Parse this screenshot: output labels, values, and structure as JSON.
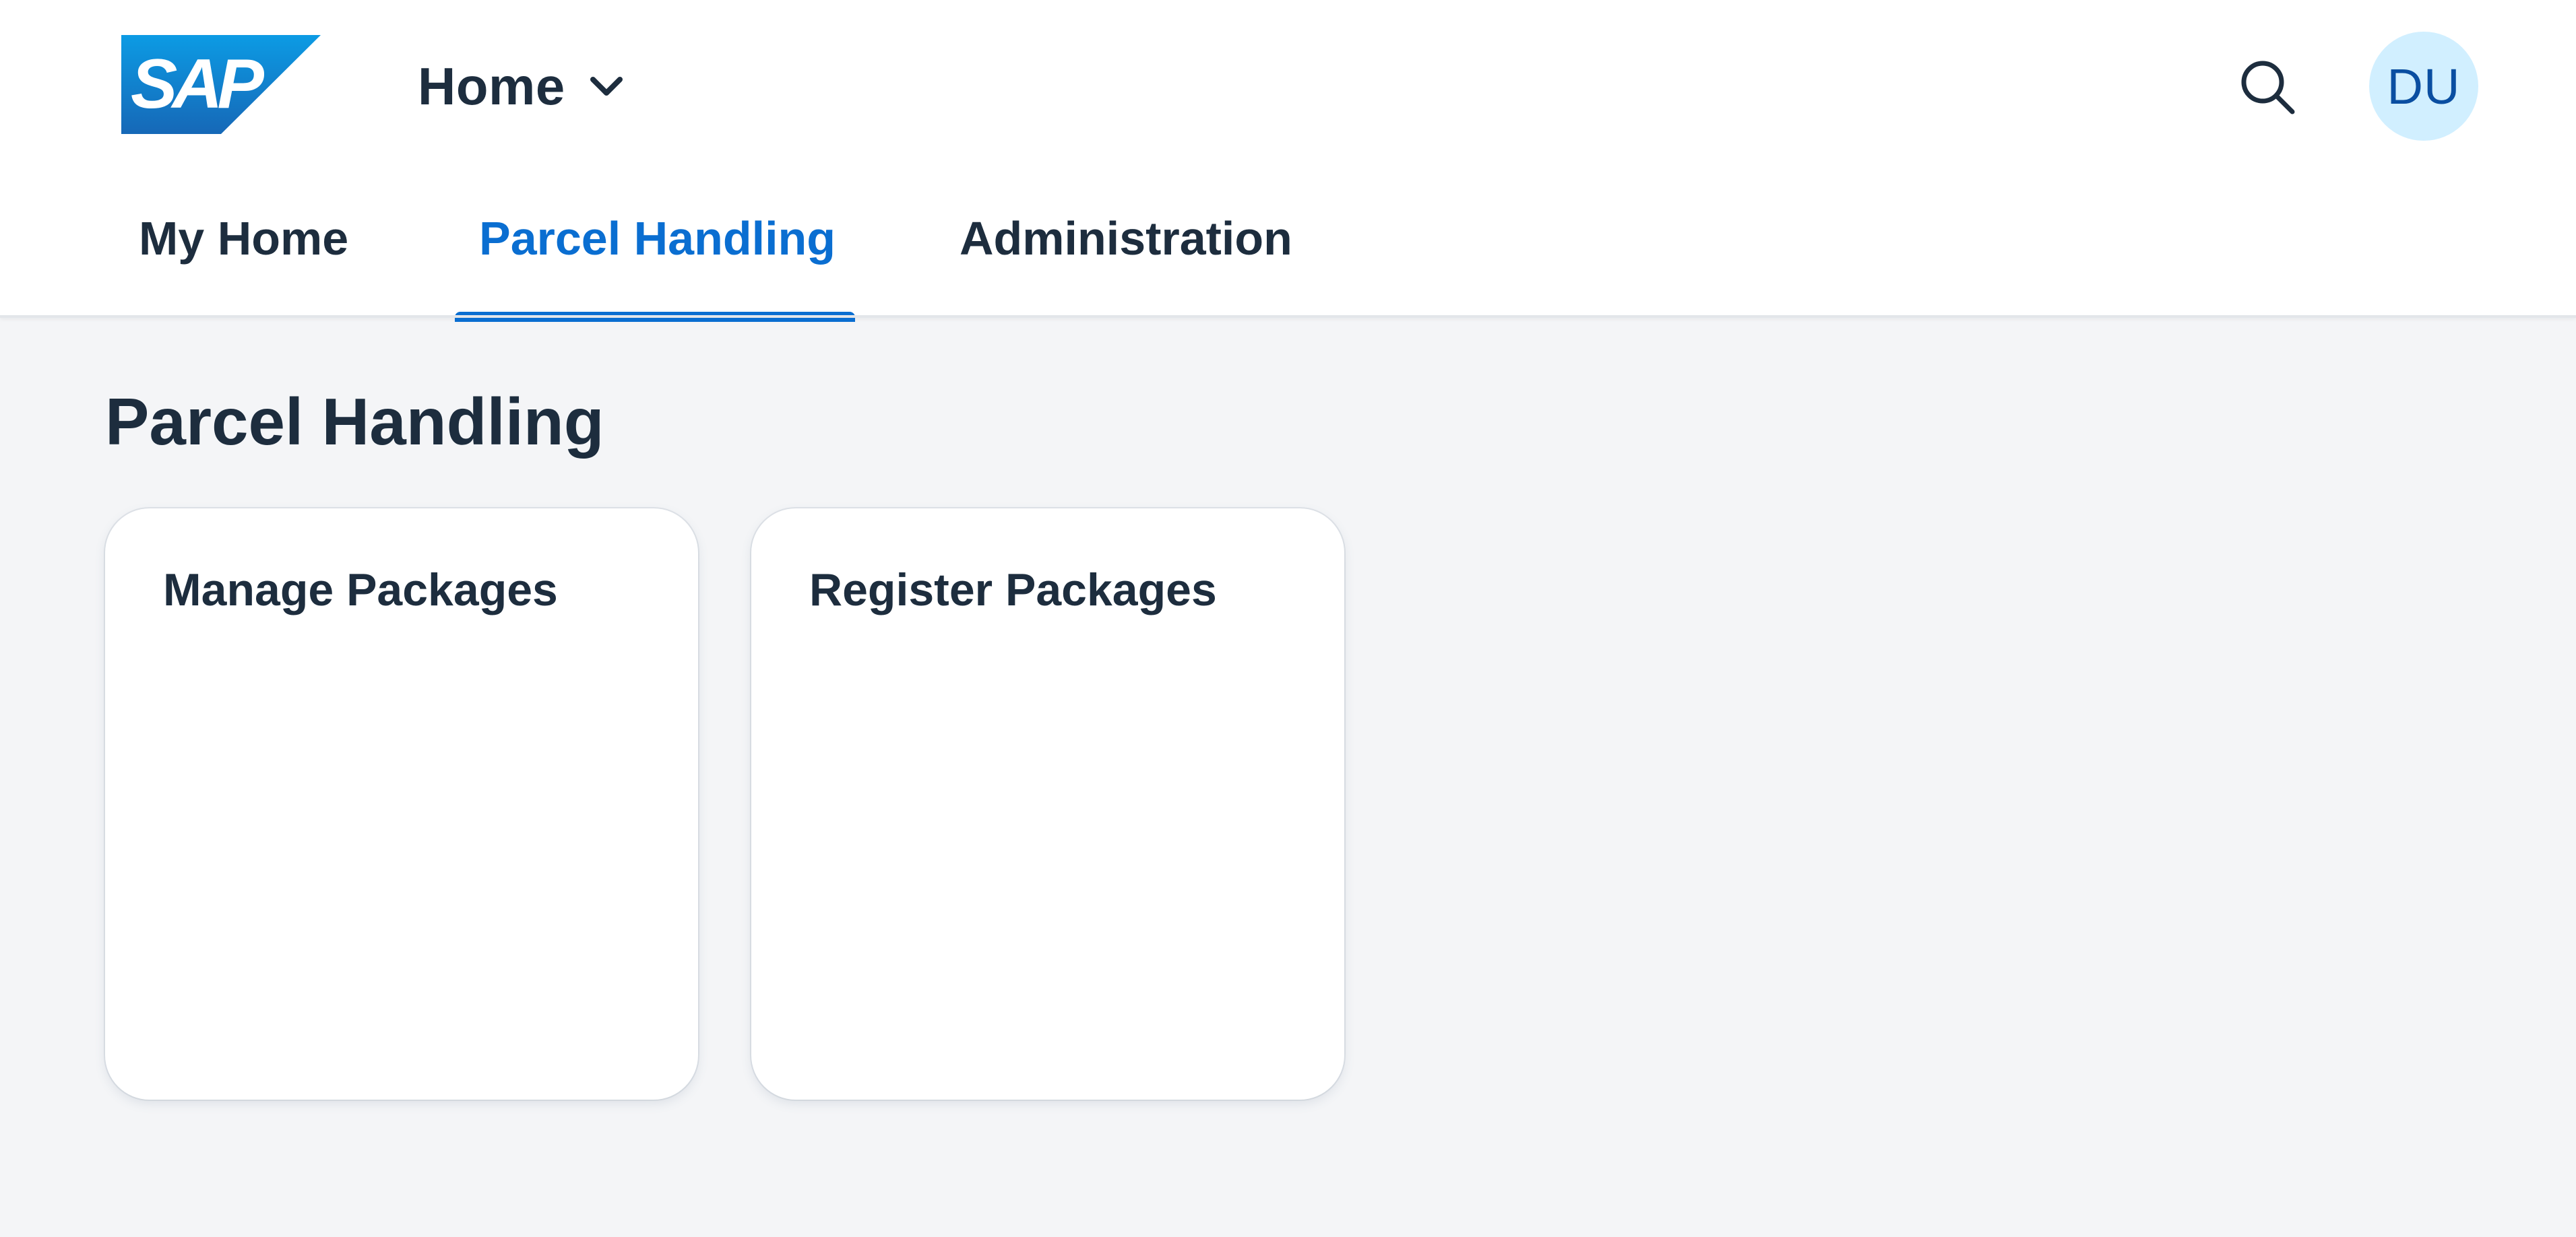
{
  "header": {
    "logo": {
      "text": "SAP",
      "icon": "sap-logo",
      "colors": {
        "gradient_start": "#0c9be4",
        "gradient_end": "#1668b7",
        "text": "#ffffff"
      }
    },
    "home_title": "Home",
    "home_chevron_icon": "chevron-down-icon",
    "search_icon": "search-icon",
    "avatar": {
      "initials": "DU",
      "background": "#d1efff",
      "text_color": "#0a4ea1"
    }
  },
  "tabs": [
    {
      "label": "My Home",
      "active": false
    },
    {
      "label": "Parcel Handling",
      "active": true
    },
    {
      "label": "Administration",
      "active": false
    }
  ],
  "main": {
    "page_title": "Parcel Handling",
    "tiles": [
      {
        "title": "Manage Packages"
      },
      {
        "title": "Register Packages"
      }
    ]
  },
  "colors": {
    "accent": "#0a6ed1",
    "text": "#1d2d3e",
    "page_background": "#f4f5f7",
    "tile_background": "#ffffff"
  }
}
